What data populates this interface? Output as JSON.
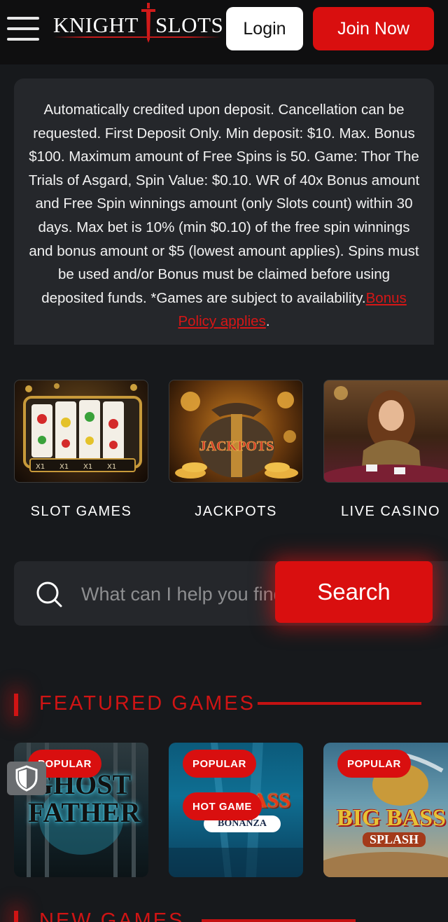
{
  "header": {
    "logo_left": "KNIGHT",
    "logo_right": "SLOTS",
    "login_label": "Login",
    "join_label": "Join Now"
  },
  "terms": {
    "text": "Automatically credited upon deposit. Cancellation can be requested. First Deposit Only. Min deposit: $10. Max. Bonus $100. Maximum amount of Free Spins is 50. Game: Thor The Trials of Asgard, Spin Value: $0.10. WR of 40x Bonus amount and Free Spin winnings amount (only Slots count) within 30 days. Max bet is 10% (min $0.10) of the free spin winnings and bonus amount or $5 (lowest amount applies). Spins must be used and/or Bonus must be claimed before using deposited funds. *Games are subject to availability.",
    "link_label": "Bonus Policy applies",
    "trailing": "."
  },
  "categories": [
    {
      "label": "SLOT GAMES",
      "image_text": "X1"
    },
    {
      "label": "JACKPOTS",
      "image_text": "JACKPOTS"
    },
    {
      "label": "LIVE CASINO"
    }
  ],
  "search": {
    "placeholder": "What can I help you find?",
    "button_label": "Search"
  },
  "featured": {
    "title": "FEATURED GAMES",
    "games": [
      {
        "badge": "POPULAR",
        "art_line1": "GHOST",
        "art_line2": "FATHER"
      },
      {
        "badge": "POPULAR",
        "badge2": "HOT GAME",
        "art_line1": "BIG BASS",
        "art_line2": "BONANZA"
      },
      {
        "badge": "POPULAR",
        "art_line1": "BIG BASS",
        "art_line2": "SPLASH"
      }
    ]
  },
  "new_games": {
    "title": "NEW GAMES"
  },
  "colors": {
    "accent": "#d90f0f",
    "background": "#17191c",
    "panel": "#25272b"
  },
  "icons": [
    "menu-icon",
    "sword-icon",
    "search-icon",
    "shield-icon"
  ]
}
